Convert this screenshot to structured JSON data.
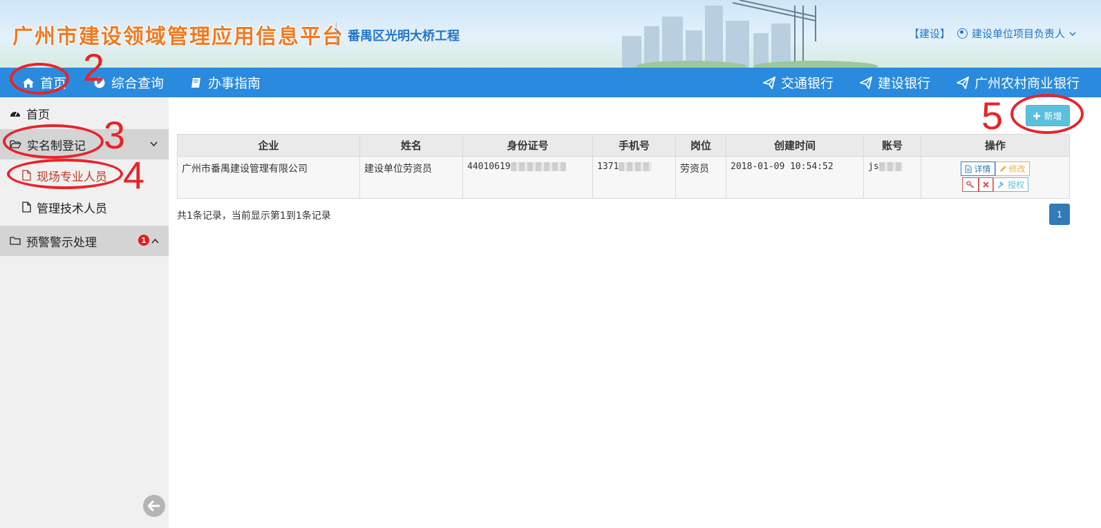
{
  "header": {
    "platform_title": "广州市建设领域管理应用信息平台",
    "project_name": "番禺区光明大桥工程",
    "role_tag": "【建设】",
    "user_name": "建设单位项目负责人",
    "user_icon": "user-circle-icon",
    "dropdown_icon": "chevron-down-icon"
  },
  "navbar": {
    "left": [
      {
        "label": "首页",
        "icon": "home-icon"
      },
      {
        "label": "综合查询",
        "icon": "globe-icon"
      },
      {
        "label": "办事指南",
        "icon": "book-icon"
      }
    ],
    "right": [
      {
        "label": "交通银行",
        "icon": "paper-plane-icon"
      },
      {
        "label": "建设银行",
        "icon": "paper-plane-icon"
      },
      {
        "label": "广州农村商业银行",
        "icon": "paper-plane-icon"
      }
    ]
  },
  "sidebar": {
    "items": [
      {
        "label": "首页",
        "icon": "dashboard-icon"
      },
      {
        "label": "实名制登记",
        "icon": "folder-open-icon",
        "expanded": true
      },
      {
        "label": "现场专业人员",
        "icon": "file-icon",
        "active": true
      },
      {
        "label": "管理技术人员",
        "icon": "file-icon"
      },
      {
        "label": "预警警示处理",
        "icon": "folder-icon",
        "badge": "1"
      }
    ],
    "collapse_icon": "arrow-left-circle-icon"
  },
  "toolbar": {
    "add_label": "新增",
    "add_icon": "plus-icon"
  },
  "table": {
    "columns": [
      "企业",
      "姓名",
      "身份证号",
      "手机号",
      "岗位",
      "创建时间",
      "账号",
      "操作"
    ],
    "rows": [
      {
        "company": "广州市番禺建设管理有限公司",
        "name": "建设单位劳资员",
        "id_number": "44010619",
        "phone": "1371",
        "position": "劳资员",
        "created": "2018-01-09 10:54:52",
        "account": "js"
      }
    ],
    "actions": {
      "detail": "详情",
      "edit": "修改",
      "authorize": "授权"
    }
  },
  "pager": {
    "info": "共1条记录，当前显示第1到1条记录",
    "current_page": "1"
  },
  "annotations": [
    "2",
    "3",
    "4",
    "5"
  ],
  "colors": {
    "navbar": "#2a8ade",
    "annotation": "#e8232a",
    "title": "#f07a22",
    "primary": "#337ab7",
    "info": "#5bc0de"
  }
}
